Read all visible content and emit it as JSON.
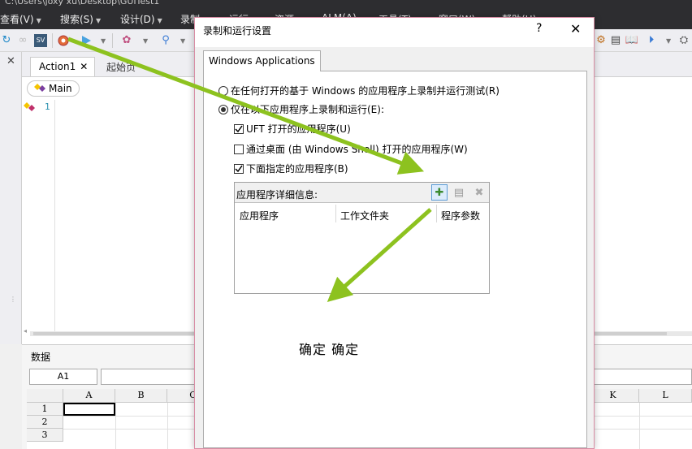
{
  "window": {
    "title_path": "C:\\Users\\joxy xu\\Desktop\\GUITest1"
  },
  "menu": [
    {
      "label": "查看(V)"
    },
    {
      "label": "搜索(S)"
    },
    {
      "label": "设计(D)"
    },
    {
      "label": "录制"
    },
    {
      "label": "运行"
    },
    {
      "label": "资源"
    },
    {
      "label": "ALM(A)"
    },
    {
      "label": "工具(T)"
    },
    {
      "label": "窗口(W)"
    },
    {
      "label": "帮助(H)"
    }
  ],
  "toolbar": {
    "icons": [
      "refresh-icon",
      "link-icon",
      "sv-icon",
      "record-icon",
      "run-icon",
      "object-spy-icon",
      "checkpoint-icon",
      "settings-icon",
      "properties-icon",
      "book-icon",
      "step-icon",
      "spy-icon"
    ]
  },
  "editor": {
    "tabs": [
      {
        "label": "Action1",
        "active": true
      },
      {
        "label": "起始页",
        "active": false
      }
    ],
    "main_label": "Main",
    "line_number": "1"
  },
  "data_pane": {
    "title": "数据",
    "cell_ref": "A1",
    "columns": [
      "A",
      "B",
      "C",
      "K",
      "L"
    ],
    "rows": [
      "1",
      "2",
      "3"
    ]
  },
  "dialog": {
    "title": "录制和运行设置",
    "help": "?",
    "close": "✕",
    "tab": "Windows Applications",
    "radio_any": "在任何打开的基于 Windows 的应用程序上录制并运行测试(R)",
    "radio_only": "仅在以下应用程序上录制和运行(E):",
    "cb_uft": "UFT 打开的应用程序(U)",
    "cb_desktop": "通过桌面 (由 Windows Shell) 打开的应用程序(W)",
    "cb_listed": "下面指定的应用程序(B)",
    "details_title": "应用程序详细信息:",
    "columns": [
      "应用程序",
      "工作文件夹",
      "程序参数"
    ],
    "radio_any_selected": false,
    "radio_only_selected": true,
    "cb_uft_checked": true,
    "cb_desktop_checked": false,
    "cb_listed_checked": true
  },
  "annotation": "确定 确定",
  "colors": {
    "arrow": "#8dc21f",
    "menubar": "#2d2d30",
    "dialog_border": "#d88ea5"
  }
}
